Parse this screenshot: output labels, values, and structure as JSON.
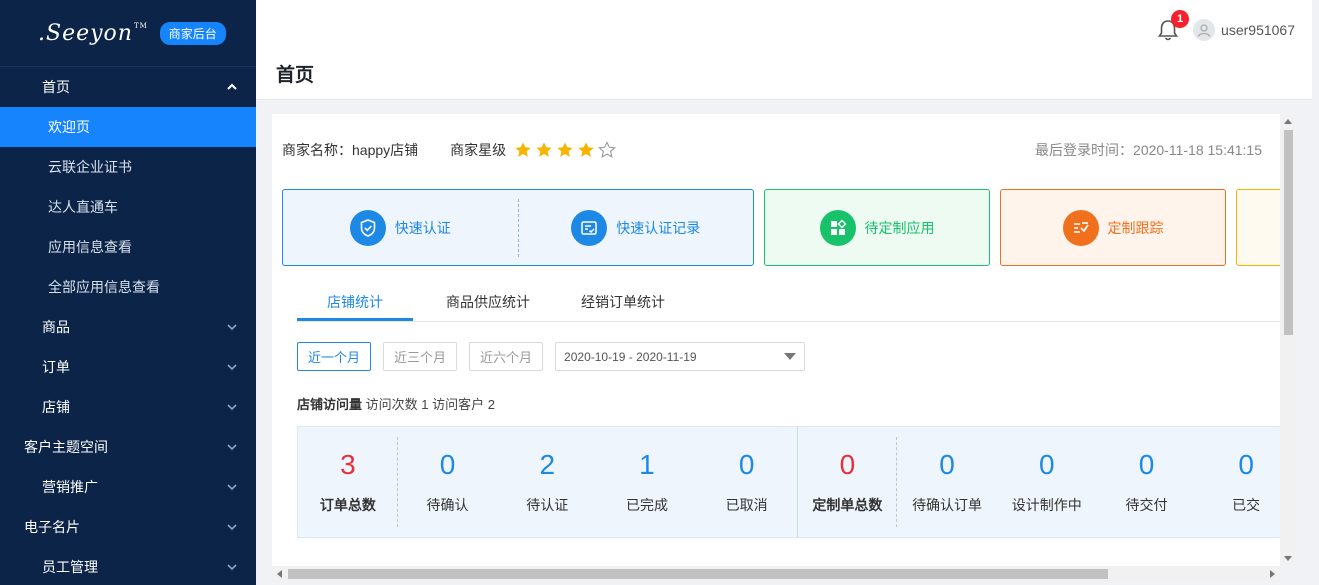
{
  "brand": {
    "logo_text": ".Seeyon",
    "tm": "TM",
    "badge": "商家后台"
  },
  "sidebar": {
    "items": [
      {
        "label": "首页"
      },
      {
        "label": "欢迎页"
      },
      {
        "label": "云联企业证书"
      },
      {
        "label": "达人直通车"
      },
      {
        "label": "应用信息查看"
      },
      {
        "label": "全部应用信息查看"
      },
      {
        "label": "商品"
      },
      {
        "label": "订单"
      },
      {
        "label": "店铺"
      },
      {
        "label": "客户主题空间"
      },
      {
        "label": "营销推广"
      },
      {
        "label": "电子名片"
      },
      {
        "label": "员工管理"
      }
    ]
  },
  "header": {
    "page_title": "首页",
    "notification_count": "1",
    "username": "user951067"
  },
  "info": {
    "merchant_name": "商家名称：happy店铺",
    "rating_label": "商家星级",
    "rating_value": 4,
    "rating_max": 5,
    "last_login": "最后登录时间：2020-11-18 15:41:15"
  },
  "quick_actions": [
    {
      "label": "快速认证",
      "icon": "shield-check-icon",
      "color": "#1e88e5"
    },
    {
      "label": "快速认证记录",
      "icon": "list-check-icon",
      "color": "#1e88e5"
    },
    {
      "label": "待定制应用",
      "icon": "apps-icon",
      "color": "#18c26a"
    },
    {
      "label": "定制跟踪",
      "icon": "track-icon",
      "color": "#f0701e"
    }
  ],
  "tabs": [
    {
      "label": "店铺统计"
    },
    {
      "label": "商品供应统计"
    },
    {
      "label": "经销订单统计"
    }
  ],
  "filters": {
    "range_buttons": [
      "近一个月",
      "近三个月",
      "近六个月"
    ],
    "selected": "近一个月",
    "date_range": "2020-10-19 - 2020-11-19"
  },
  "visit": {
    "title": "店铺访问量",
    "summary": "访问次数 1 访问客户 2"
  },
  "stats": [
    {
      "value": "3",
      "label": "订单总数"
    },
    {
      "value": "0",
      "label": "待确认"
    },
    {
      "value": "2",
      "label": "待认证"
    },
    {
      "value": "1",
      "label": "已完成"
    },
    {
      "value": "0",
      "label": "已取消"
    },
    {
      "value": "0",
      "label": "定制单总数"
    },
    {
      "value": "0",
      "label": "待确认订单"
    },
    {
      "value": "0",
      "label": "设计制作中"
    },
    {
      "value": "0",
      "label": "待交付"
    },
    {
      "value": "0",
      "label": "已交"
    }
  ],
  "colors": {
    "sidebar_bg": "#0b2447",
    "accent": "#1684fc",
    "total_red": "#e8303a"
  }
}
